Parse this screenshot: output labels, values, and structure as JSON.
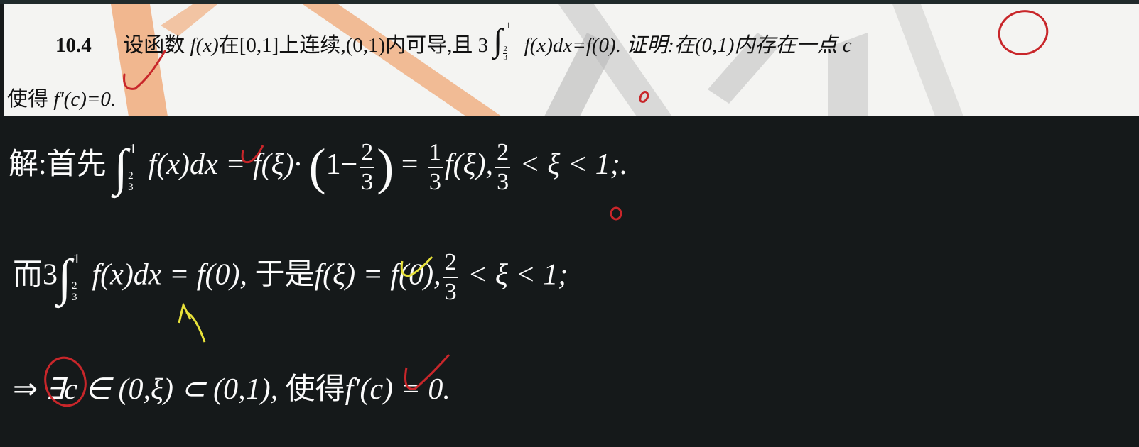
{
  "problem": {
    "number": "10.4",
    "line1_a": "设函数",
    "line1_fx": "f(x)",
    "line1_b": "在[0,1]上连续,(0,1)内可导,且 3",
    "int_upper": "1",
    "int_lower_num": "2",
    "int_lower_den": "3",
    "line1_c": "f(x)dx=f(0). 证明:在(0,1)内存在一点",
    "line1_tail": "c",
    "line2_a": "使得",
    "line2_b": "f′(c)=0."
  },
  "solution": {
    "line1": {
      "lead": "解:首先",
      "int_upper": "1",
      "int_lower_num": "2",
      "int_lower_den": "3",
      "expr_a": "f(x)dx = f(ξ)·",
      "paren_open": "(",
      "one_minus": "1−",
      "frac1_num": "2",
      "frac1_den": "3",
      "paren_close": ")",
      "eq": "=",
      "frac2_num": "1",
      "frac2_den": "3",
      "expr_b": "f(ξ),",
      "frac3_num": "2",
      "frac3_den": "3",
      "expr_c": "< ξ < 1;."
    },
    "line2": {
      "lead": "而3",
      "int_upper": "1",
      "int_lower_num": "2",
      "int_lower_den": "3",
      "expr_a": "f(x)dx = f(0),",
      "mid": "于是",
      "expr_b": "f(ξ) = f(0),",
      "frac_num": "2",
      "frac_den": "3",
      "expr_c": "< ξ < 1;"
    },
    "line3": {
      "arrow": "⇒",
      "expr_a": "∃c ∈ (0,ξ) ⊂ (0,1),",
      "mid": "使得",
      "expr_b": "f′(c) = 0."
    }
  },
  "colors": {
    "red_ink": "#c8262a",
    "yellow_ink": "#e8e23a",
    "watermark_orange": "#f0a36e",
    "watermark_gray": "#b7b7b7"
  }
}
